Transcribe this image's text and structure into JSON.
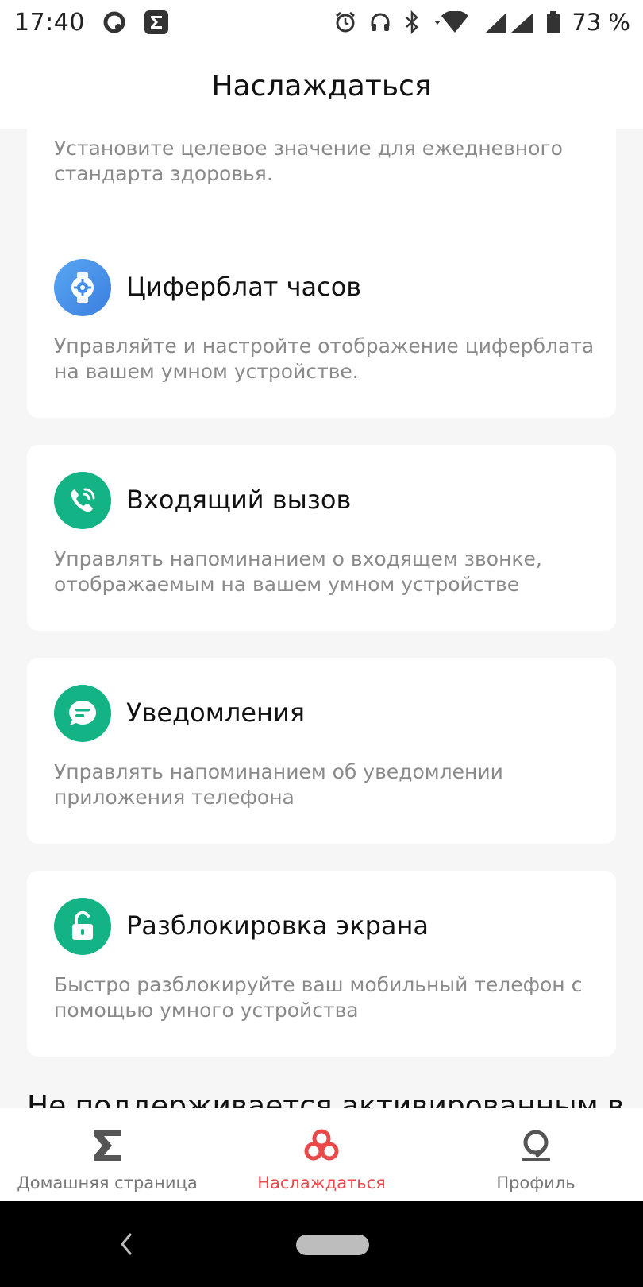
{
  "status_bar": {
    "time": "17:40",
    "battery": "73 %",
    "icons": [
      "assistant-icon",
      "sigma-app-icon",
      "alarm-icon",
      "headphones-icon",
      "bluetooth-icon",
      "wifi-icon",
      "signal-icon",
      "battery-icon"
    ]
  },
  "header": {
    "title": "Наслаждаться"
  },
  "top_card": {
    "description": "Установите целевое значение для ежедневного стандарта здоровья."
  },
  "features": [
    {
      "title": "Циферблат часов",
      "description": "Управляйте и настройте отображение циферблата на вашем умном устройстве.",
      "icon": "watch-face-icon",
      "color": "#3f8cea"
    },
    {
      "title": "Входящий вызов",
      "description": "Управлять напоминанием о входящем звонке, отображаемым на вашем умном устройстве",
      "icon": "phone-call-icon",
      "color": "#13b386"
    },
    {
      "title": "Уведомления",
      "description": "Управлять напоминанием об уведомлении приложения телефона",
      "icon": "message-icon",
      "color": "#13b386"
    },
    {
      "title": "Разблокировка экрана",
      "description": "Быстро разблокируйте ваш мобильный телефон с помощью умного устройства",
      "icon": "unlock-icon",
      "color": "#13b386"
    }
  ],
  "section_heading": "Не поддерживается активированным в",
  "bottom_nav": {
    "items": [
      {
        "label": "Домашняя страница",
        "icon": "sigma-icon",
        "active": false
      },
      {
        "label": "Наслаждаться",
        "icon": "enjoy-icon",
        "active": true
      },
      {
        "label": "Профиль",
        "icon": "profile-icon",
        "active": false
      }
    ],
    "active_color": "#e84a4a"
  }
}
